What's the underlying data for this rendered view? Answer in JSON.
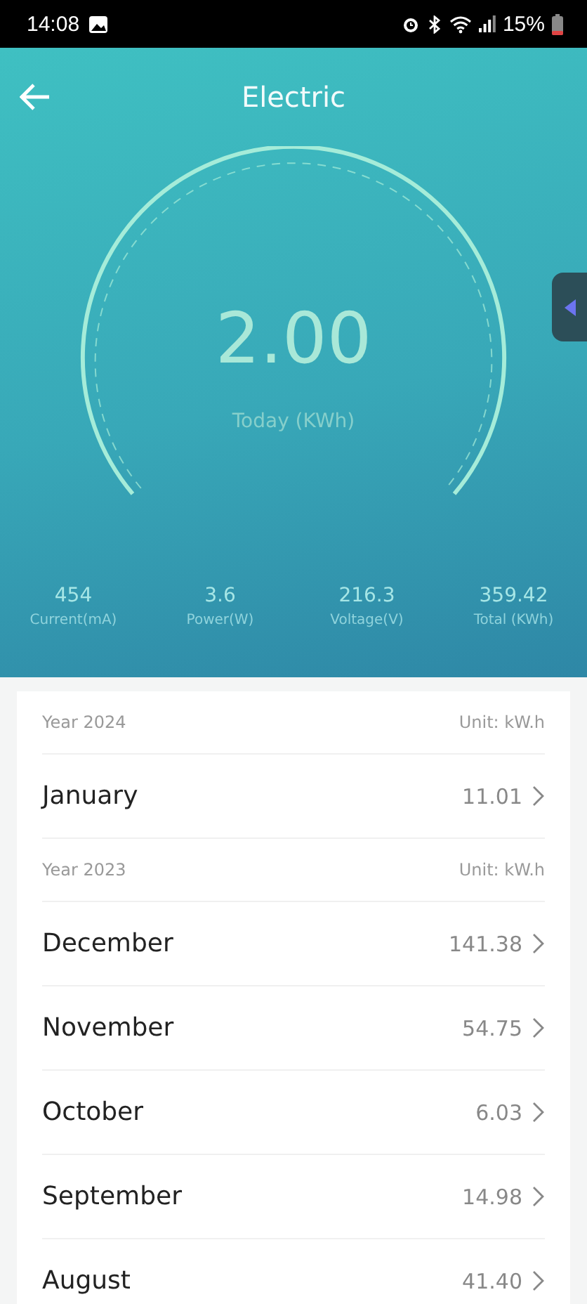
{
  "status_bar": {
    "time": "14:08",
    "battery": "15%"
  },
  "header": {
    "title": "Electric"
  },
  "gauge": {
    "value": "2.00",
    "label": "Today (KWh)"
  },
  "stats": [
    {
      "value": "454",
      "label": "Current(mA)"
    },
    {
      "value": "3.6",
      "label": "Power(W)"
    },
    {
      "value": "216.3",
      "label": "Voltage(V)"
    },
    {
      "value": "359.42",
      "label": "Total (KWh)"
    }
  ],
  "years": [
    {
      "title": "Year 2024",
      "unit": "Unit: kW.h",
      "months": [
        {
          "name": "January",
          "value": "11.01"
        }
      ]
    },
    {
      "title": "Year 2023",
      "unit": "Unit: kW.h",
      "months": [
        {
          "name": "December",
          "value": "141.38"
        },
        {
          "name": "November",
          "value": "54.75"
        },
        {
          "name": "October",
          "value": "6.03"
        },
        {
          "name": "September",
          "value": "14.98"
        },
        {
          "name": "August",
          "value": "41.40"
        }
      ]
    }
  ]
}
